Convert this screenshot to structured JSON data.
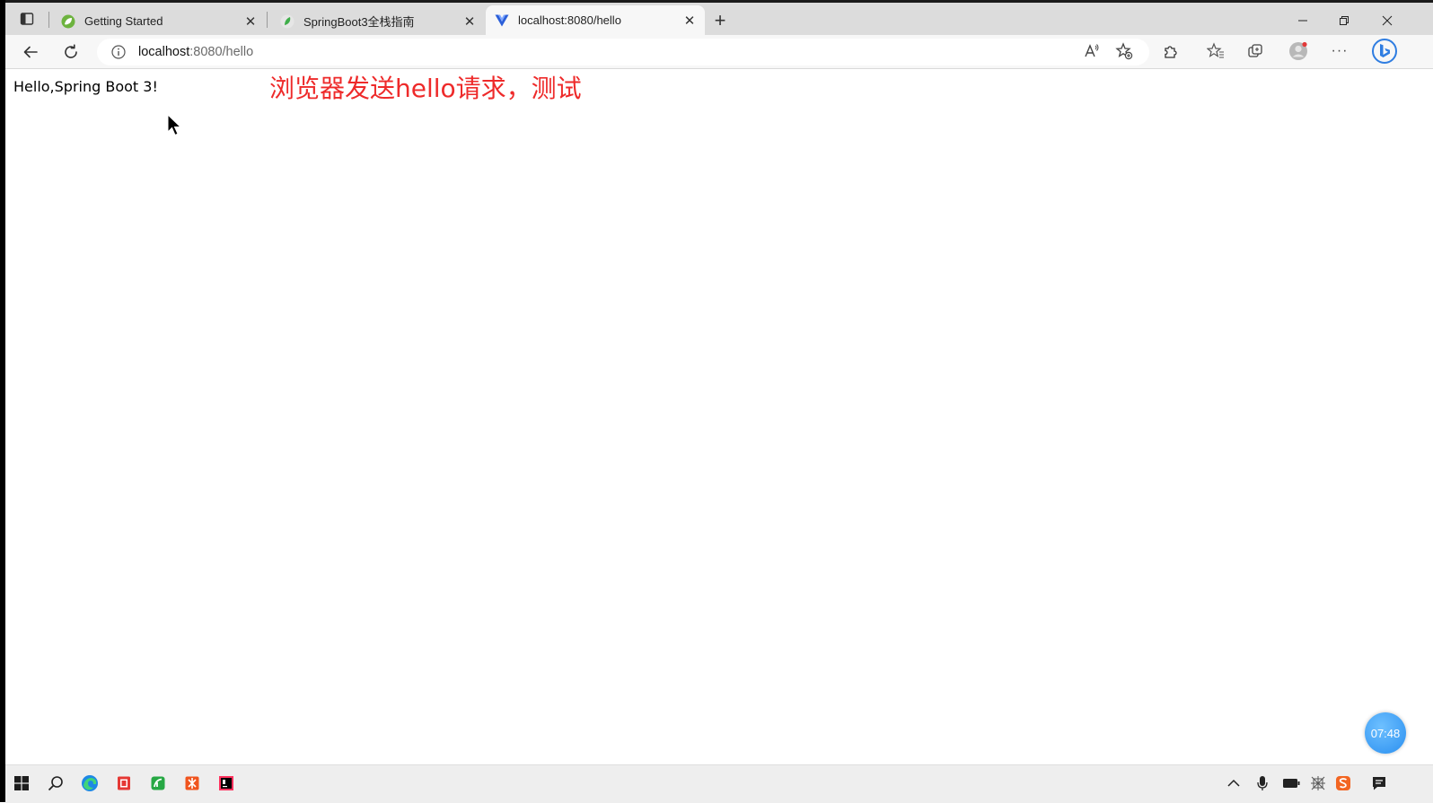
{
  "browser": {
    "tabs": [
      {
        "title": "Getting Started",
        "active": false
      },
      {
        "title": "SpringBoot3全栈指南",
        "active": false
      },
      {
        "title": "localhost:8080/hello",
        "active": true
      }
    ],
    "address": {
      "host": "localhost",
      "path": ":8080/hello"
    }
  },
  "page": {
    "body_text": "Hello,Spring Boot 3!",
    "annotation": "浏览器发送hello请求，测试"
  },
  "overlay": {
    "timer": "07:48"
  },
  "colors": {
    "annotation": "#ee2a2a",
    "tab_bar": "#dcdcdc",
    "toolbar": "#f7f7f7",
    "timer": "#2a8ff0"
  }
}
